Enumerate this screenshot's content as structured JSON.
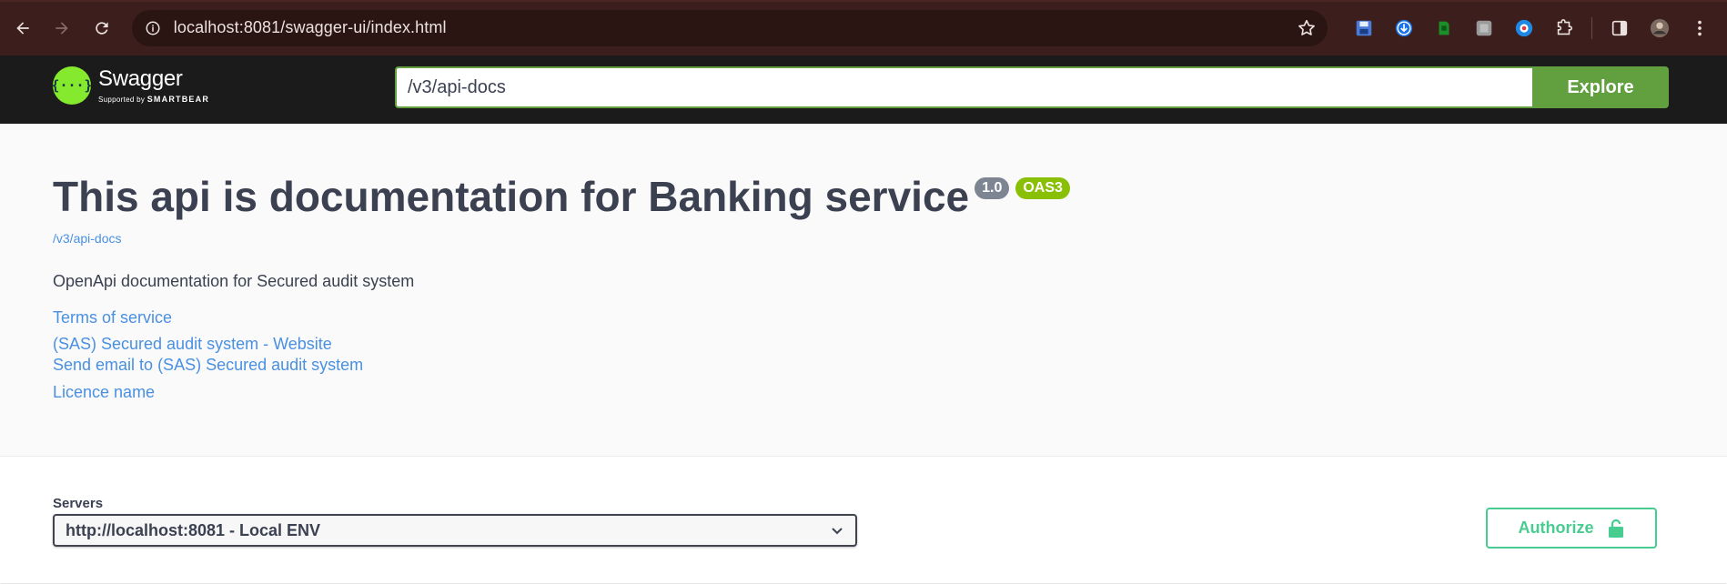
{
  "browser": {
    "url": "localhost:8081/swagger-ui/index.html",
    "icons": [
      "back-icon",
      "forward-icon",
      "reload-icon",
      "site-info-icon",
      "bookmark-star-icon"
    ],
    "extensions": [
      "save-extension-icon",
      "download-extension-icon",
      "green-extension-icon",
      "grey-extension-icon",
      "blue-extension-icon",
      "puzzle-extensions-icon",
      "side-panel-icon",
      "profile-avatar-icon",
      "menu-kebab-icon"
    ]
  },
  "topbar": {
    "logo_name": "Swagger",
    "logo_sub_prefix": "Supported by",
    "logo_sub_brand": "SMARTBEAR",
    "spec_url": "/v3/api-docs",
    "explore_label": "Explore",
    "brand_color": "#85ea2d",
    "button_color": "#62a03f"
  },
  "info": {
    "title": "This api is documentation for Banking service",
    "version": "1.0",
    "oas_badge": "OAS3",
    "spec_link": "/v3/api-docs",
    "description": "OpenApi documentation for Secured audit system",
    "terms_link": "Terms of service",
    "website_link": "(SAS) Secured audit system - Website",
    "email_link": "Send email to (SAS) Secured audit system",
    "licence_link": "Licence name",
    "link_color": "#4990e2"
  },
  "scheme": {
    "servers_label": "Servers",
    "selected_server": "http://localhost:8081 - Local ENV",
    "authorize_label": "Authorize",
    "authorize_color": "#49cc90"
  }
}
